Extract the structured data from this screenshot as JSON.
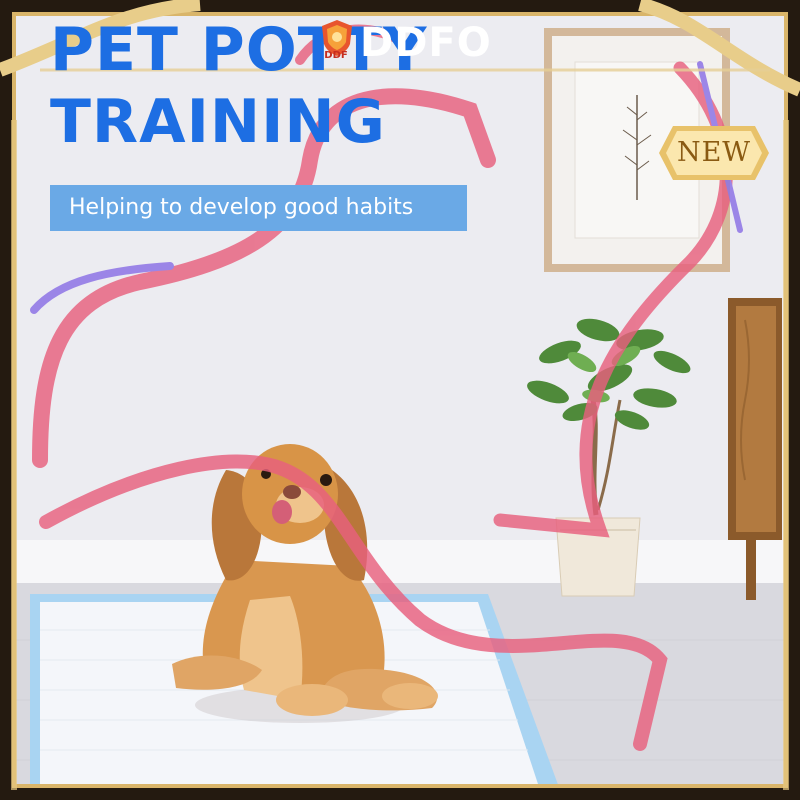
{
  "headline": {
    "line1": "PET POTTY",
    "line2": "TRAINING"
  },
  "tagline": "Helping to develop good habits",
  "brand": {
    "crest_text": "DDF",
    "name": "DDFO"
  },
  "badge": {
    "label": "NEW"
  },
  "colors": {
    "headline": "#1d6ee3",
    "tagline_bg": "#6aa9e6",
    "ribbon": "#e8607e",
    "frame_gold": "#d9b56a",
    "pad_border": "#a9d4f2",
    "wall": "#e7e7ec"
  },
  "icons": [
    "brand-crest-icon",
    "new-badge-icon"
  ]
}
